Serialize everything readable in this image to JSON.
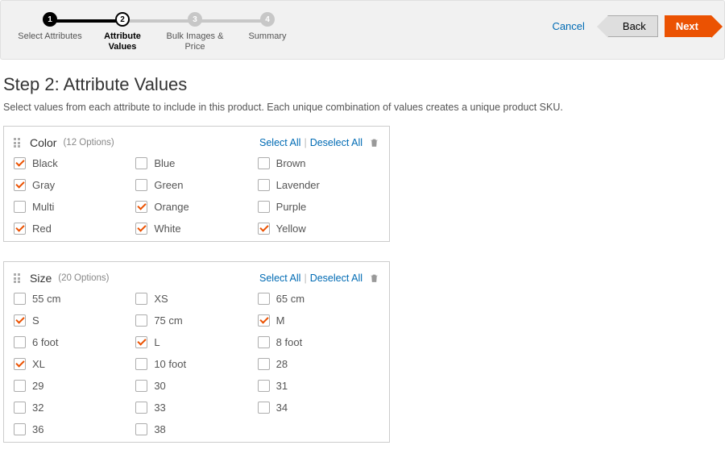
{
  "wizard": {
    "steps": [
      {
        "num": "1",
        "label": "Select Attributes",
        "state": "done"
      },
      {
        "num": "2",
        "label": "Attribute Values",
        "state": "active"
      },
      {
        "num": "3",
        "label": "Bulk Images & Price",
        "state": ""
      },
      {
        "num": "4",
        "label": "Summary",
        "state": ""
      }
    ],
    "cancel": "Cancel",
    "back": "Back",
    "next": "Next"
  },
  "page": {
    "title": "Step 2: Attribute Values",
    "subtitle": "Select values from each attribute to include in this product. Each unique combination of values creates a unique product SKU."
  },
  "selectAll": "Select All",
  "deselectAll": "Deselect All",
  "attributes": [
    {
      "name": "Color",
      "count": "(12 Options)",
      "options": [
        {
          "label": "Black",
          "checked": true
        },
        {
          "label": "Blue",
          "checked": false
        },
        {
          "label": "Brown",
          "checked": false
        },
        {
          "label": "Gray",
          "checked": true
        },
        {
          "label": "Green",
          "checked": false
        },
        {
          "label": "Lavender",
          "checked": false
        },
        {
          "label": "Multi",
          "checked": false
        },
        {
          "label": "Orange",
          "checked": true
        },
        {
          "label": "Purple",
          "checked": false
        },
        {
          "label": "Red",
          "checked": true
        },
        {
          "label": "White",
          "checked": true
        },
        {
          "label": "Yellow",
          "checked": true
        }
      ]
    },
    {
      "name": "Size",
      "count": "(20 Options)",
      "options": [
        {
          "label": "55 cm",
          "checked": false
        },
        {
          "label": "XS",
          "checked": false
        },
        {
          "label": "65 cm",
          "checked": false
        },
        {
          "label": "S",
          "checked": true
        },
        {
          "label": "75 cm",
          "checked": false
        },
        {
          "label": "M",
          "checked": true
        },
        {
          "label": "6 foot",
          "checked": false
        },
        {
          "label": "L",
          "checked": true
        },
        {
          "label": "8 foot",
          "checked": false
        },
        {
          "label": "XL",
          "checked": true
        },
        {
          "label": "10 foot",
          "checked": false
        },
        {
          "label": "28",
          "checked": false
        },
        {
          "label": "29",
          "checked": false
        },
        {
          "label": "30",
          "checked": false
        },
        {
          "label": "31",
          "checked": false
        },
        {
          "label": "32",
          "checked": false
        },
        {
          "label": "33",
          "checked": false
        },
        {
          "label": "34",
          "checked": false
        },
        {
          "label": "36",
          "checked": false
        },
        {
          "label": "38",
          "checked": false
        }
      ]
    }
  ]
}
